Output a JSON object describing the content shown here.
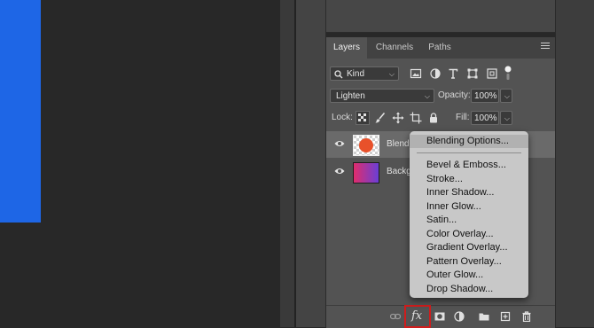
{
  "layers_panel": {
    "tabs": [
      {
        "label": "Layers",
        "active": true
      },
      {
        "label": "Channels",
        "active": false
      },
      {
        "label": "Paths",
        "active": false
      }
    ],
    "filter": {
      "kind_label": "Kind",
      "icons": [
        "image-filter-icon",
        "adjustment-filter-icon",
        "type-filter-icon",
        "shape-filter-icon",
        "smart-object-filter-icon",
        "filter-toggle-icon"
      ]
    },
    "blend_mode": "Lighten",
    "opacity_label": "Opacity:",
    "opacity_value": "100%",
    "lock_label": "Lock:",
    "fill_label": "Fill:",
    "fill_value": "100%",
    "layers": [
      {
        "name": "Blendi",
        "thumb": "orange-circle",
        "visible": true,
        "selected": true
      },
      {
        "name": "Backgr",
        "thumb": "gradient",
        "visible": true,
        "selected": false
      }
    ],
    "bottom_icons": [
      "link-icon",
      "fx-icon",
      "mask-icon",
      "adjustment-icon",
      "group-folder-icon",
      "new-layer-icon",
      "trash-icon"
    ],
    "fx_label": "fx"
  },
  "context_menu": {
    "top_item": "Blending Options...",
    "items": [
      "Bevel & Emboss...",
      "Stroke...",
      "Inner Shadow...",
      "Inner Glow...",
      "Satin...",
      "Color Overlay...",
      "Gradient Overlay...",
      "Pattern Overlay...",
      "Outer Glow...",
      "Drop Shadow..."
    ]
  },
  "colors": {
    "canvas_bg": "#282828",
    "document_fill": "#1e66e6",
    "panel_bg": "#535353",
    "highlight_box": "#d01c1c",
    "layer_thumb_orange": "#e8512a"
  }
}
